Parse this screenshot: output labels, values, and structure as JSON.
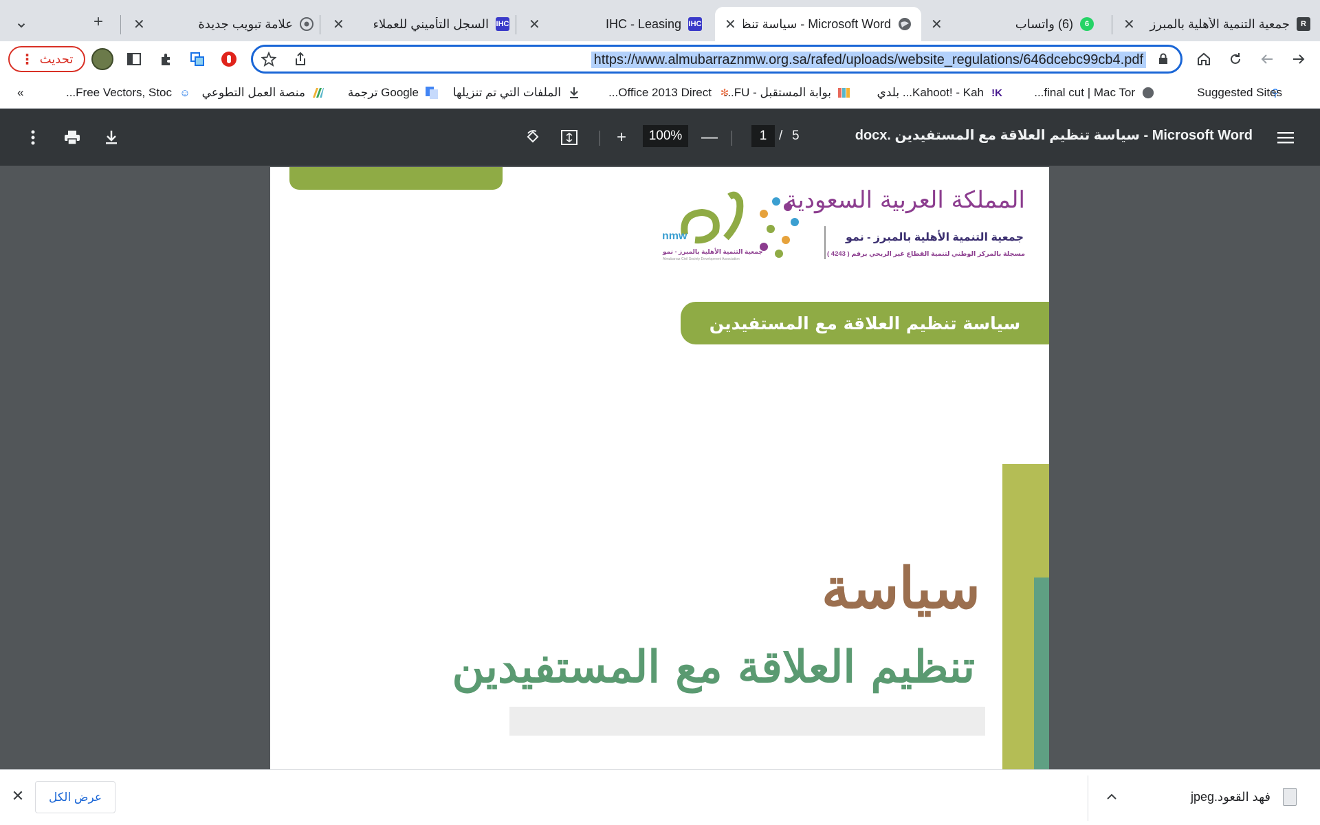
{
  "tabs": [
    {
      "title": "جمعية التنمية الأهلية بالمبرز",
      "close": "✕",
      "favicon": "R",
      "active": false
    },
    {
      "title": "(6) واتساب",
      "close": "✕",
      "favicon": "6",
      "active": false
    },
    {
      "title": "Microsoft Word - سياسة تنظيم العلاقة مع المستفيدين",
      "close": "✕",
      "favicon": "globe",
      "active": true
    },
    {
      "title": "IHC - Leasing",
      "close": "✕",
      "favicon": "IHC",
      "active": false
    },
    {
      "title": "السجل التأميني للعملاء",
      "close": "✕",
      "favicon": "IHC",
      "active": false
    },
    {
      "title": "علامة تبويب جديدة",
      "close": "✕",
      "favicon": "chrome",
      "active": false
    }
  ],
  "tabstrip": {
    "new_tab": "+",
    "tab_search": "⌄"
  },
  "toolbar": {
    "url": "https://www.almubarraznmw.org.sa/rafed/uploads/website_regulations/646dcebc99cb4.pdf",
    "update_label": "تحديث",
    "update_dots": "⋮"
  },
  "bookmarks": [
    {
      "label": "Suggested Sites"
    },
    {
      "label": "final cut | Mac Tor..."
    },
    {
      "label": "Kahoot! - Kah... بلدي"
    },
    {
      "label": "بوابة المستقبل - FU..."
    },
    {
      "label": "Office 2013 Direct..."
    },
    {
      "label": "الملفات التي تم تنزيلها"
    },
    {
      "label": "Google ترجمة"
    },
    {
      "label": "منصة العمل التطوعي"
    },
    {
      "label": "Free Vectors, Stoc..."
    }
  ],
  "bookmarks_more": "»",
  "pdf": {
    "title": "Microsoft Word - سياسة تنظيم العلاقة مع المستفيدين .docx",
    "zoom": "100%",
    "page_current": "1",
    "page_sep": "/",
    "page_total": "5",
    "plus": "+",
    "minus": "—"
  },
  "document": {
    "header_band": "سياسة تنظيم العلاقة مع المستفيدين",
    "big_title_line1": "سياسة",
    "big_title_line2": "تنظيم العلاقة مع المستفيدين",
    "logo": {
      "kingdom": "المملكة العربية السعودية",
      "org_name": "جمعية التنمية الأهلية بالمبرز - نمو",
      "registration": "مسجلة بالمركز الوطني لتنمية القطاع غير الربحي برقم ( 4243 )",
      "nmw_arabic": "نمو",
      "nmw_latin": "nmw",
      "nmw_caption": "جمعية التنمية الأهلية بالمبرز - نمو",
      "nmw_caption_en": "Almubarraz Civil Society Development Association"
    },
    "colors": {
      "green": "#8fab45",
      "brown": "#9b6f4f",
      "teal": "#5a9a71",
      "lime": "#b4bd55"
    }
  },
  "downloads": {
    "close": "✕",
    "show_all": "عرض الكل",
    "chevron": "^",
    "file_name": "فهد القعود.jpeg"
  }
}
